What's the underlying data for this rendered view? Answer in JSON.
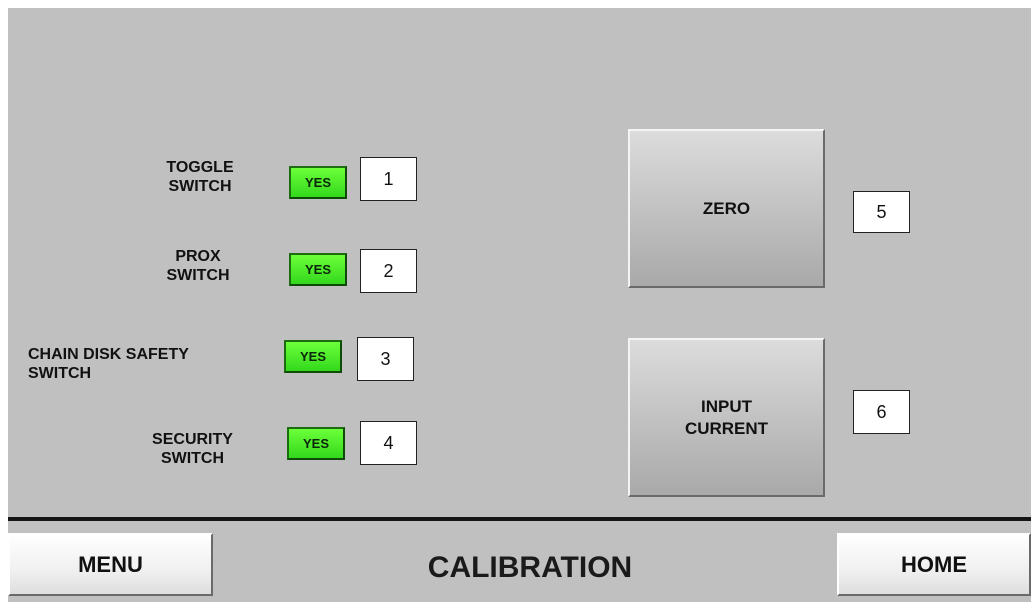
{
  "rows": [
    {
      "label": "TOGGLE\nSWITCH",
      "indicator": "YES",
      "number": "1"
    },
    {
      "label": "PROX\nSWITCH",
      "indicator": "YES",
      "number": "2"
    },
    {
      "label": "CHAIN DISK SAFETY\nSWITCH",
      "indicator": "YES",
      "number": "3"
    },
    {
      "label": "SECURITY\nSWITCH",
      "indicator": "YES",
      "number": "4"
    }
  ],
  "buttons": {
    "zero": {
      "label": "ZERO",
      "number": "5"
    },
    "input_current": {
      "label": "INPUT\nCURRENT",
      "number": "6"
    }
  },
  "footer": {
    "menu_label": "MENU",
    "title": "CALIBRATION",
    "home_label": "HOME"
  },
  "colors": {
    "panel_bg": "#c0c0c0",
    "indicator_green": "#4ee82a",
    "divider": "#151515"
  }
}
